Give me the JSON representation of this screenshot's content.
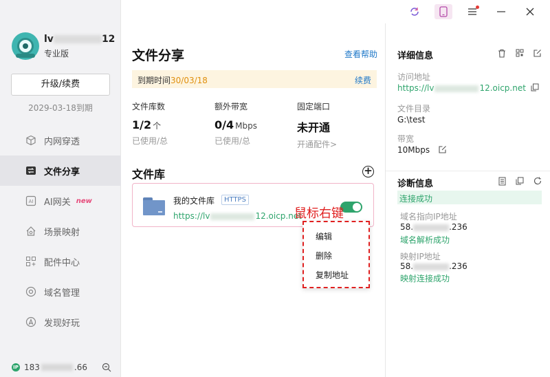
{
  "sidebar": {
    "username_prefix": "lv",
    "username_suffix": "12",
    "edition": "专业版",
    "upgrade_label": "升级/续费",
    "expire_text": "2029-03-18到期",
    "items": [
      {
        "label": "内网穿透",
        "icon": "cube-icon"
      },
      {
        "label": "文件分享",
        "icon": "file-share-icon"
      },
      {
        "label": "AI网关",
        "icon": "ai-icon",
        "badge": "new"
      },
      {
        "label": "场景映射",
        "icon": "house-icon"
      },
      {
        "label": "配件中心",
        "icon": "grid-icon"
      },
      {
        "label": "域名管理",
        "icon": "globe-icon"
      },
      {
        "label": "发现好玩",
        "icon": "compass-icon"
      }
    ],
    "footer_ip_prefix": "183",
    "footer_ip_suffix": ".66",
    "footer_ip_badge": "IP"
  },
  "main": {
    "title": "文件分享",
    "help_link": "查看帮助",
    "expiry_label": "到期时间",
    "expiry_date": "30/03/18",
    "renew_label": "续费",
    "stats": [
      {
        "name": "文件库数",
        "value": "1/2",
        "unit": "个",
        "sub": "已使用/总"
      },
      {
        "name": "额外带宽",
        "value": "0/4",
        "unit": "Mbps",
        "sub": "已使用/总"
      },
      {
        "name": "固定端口",
        "value": "未开通",
        "unit": "",
        "sub": "开通配件>"
      }
    ],
    "library_title": "文件库",
    "library": {
      "name": "我的文件库",
      "tag": "HTTPS",
      "url_prefix": "https://lv",
      "url_suffix": "12.oicp.net",
      "enabled": true
    },
    "annotation": "鼠标右键",
    "context_menu": [
      "编辑",
      "删除",
      "复制地址"
    ]
  },
  "details": {
    "title": "详细信息",
    "access_label": "访问地址",
    "access_prefix": "https://lv",
    "access_suffix": "12.oicp.net",
    "dir_label": "文件目录",
    "dir_value": "G:\\test",
    "bw_label": "带宽",
    "bw_value": "10Mbps"
  },
  "diagnosis": {
    "title": "诊断信息",
    "status": "连接成功",
    "domain_ip_label": "域名指向IP地址",
    "domain_ip_prefix": "58.",
    "domain_ip_suffix": ".236",
    "domain_ok": "域名解析成功",
    "map_ip_label": "映射IP地址",
    "map_ip_prefix": "58.",
    "map_ip_suffix": ".236",
    "map_ok": "映射连接成功"
  },
  "colors": {
    "accent_green": "#2ea46c",
    "link_blue": "#1f78c8",
    "expiry_orange": "#e0900e",
    "annotation_red": "#e02020"
  }
}
